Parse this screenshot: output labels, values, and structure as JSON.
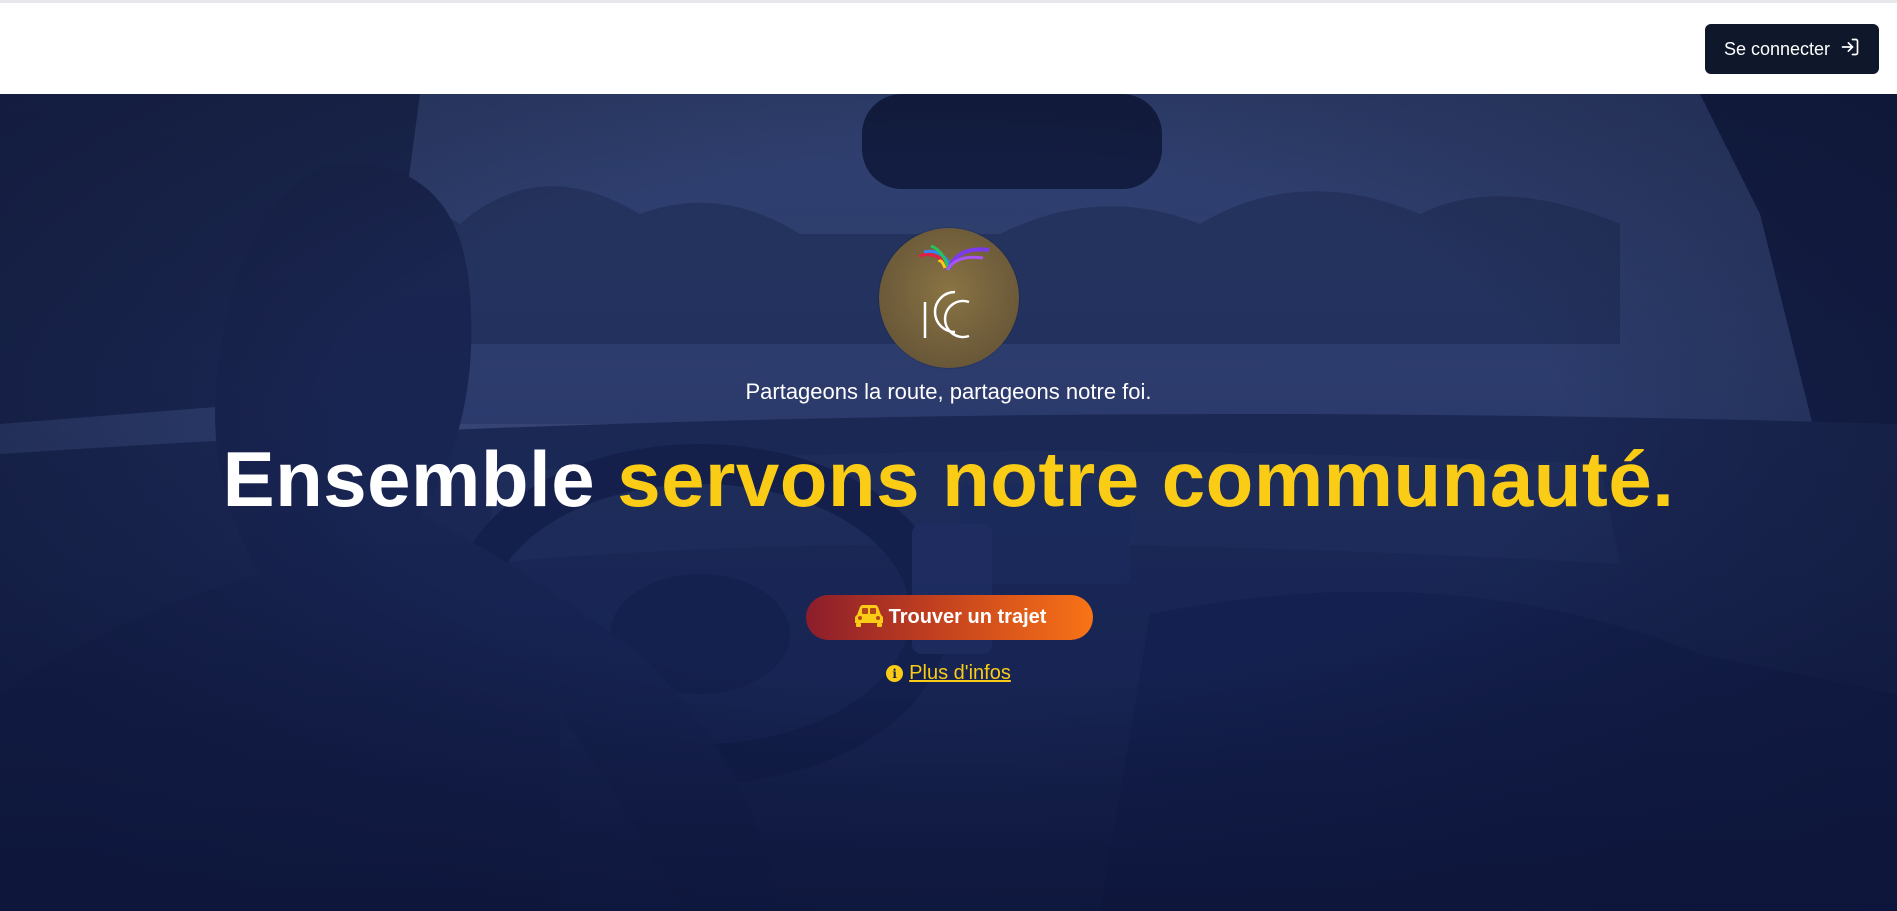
{
  "navbar": {
    "login_label": "Se connecter",
    "login_icon": "log-in-icon"
  },
  "hero": {
    "logo_text": "ICC",
    "tagline": "Partageons la route, partageons notre foi.",
    "headline_white": "Ensemble ",
    "headline_yellow": "servons notre communauté.",
    "cta_label": "Trouver un trajet",
    "cta_icon": "car-icon",
    "more_label": "Plus d'infos",
    "more_icon": "info-icon"
  },
  "colors": {
    "accent_yellow": "#facc15",
    "navy": "#1a2550",
    "button_dark": "#0f172a",
    "cta_start": "#8b1d2c",
    "cta_end": "#f97316"
  }
}
